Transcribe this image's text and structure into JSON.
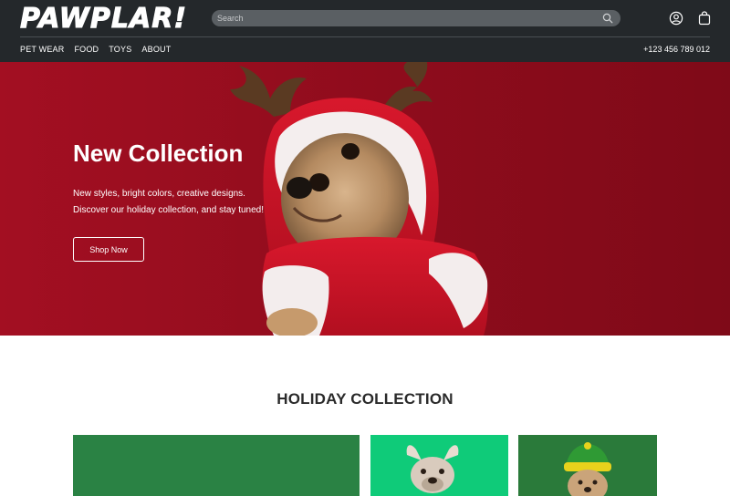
{
  "brand": {
    "logo_text": "PAWPLAR!"
  },
  "search": {
    "placeholder": "Search"
  },
  "nav": {
    "items": [
      "PET WEAR",
      "FOOD",
      "TOYS",
      "ABOUT"
    ]
  },
  "contact": {
    "phone": "+123 456 789 012"
  },
  "hero": {
    "title": "New Collection",
    "subtitle_line1": "New styles, bright colors, creative designs.",
    "subtitle_line2": "Discover our holiday collection, and stay tuned!",
    "button_label": "Shop Now"
  },
  "collection": {
    "title": "HOLIDAY COLLECTION"
  },
  "icons": {
    "search": "search-icon",
    "user": "user-icon",
    "bag": "shopping-bag-icon"
  },
  "colors": {
    "header": "#24282b",
    "hero_bg": "#9b0d1f",
    "card_green": "#2e8a48",
    "card_mint": "#0fcb79"
  }
}
